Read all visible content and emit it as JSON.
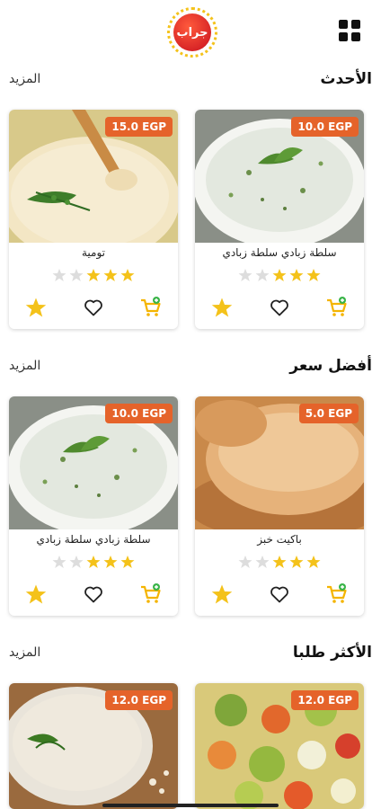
{
  "header": {
    "logo_text": "جراب",
    "menu_icon": "grid-menu-icon"
  },
  "sections": [
    {
      "title": "الأحدث",
      "more_label": "المزيد",
      "cards": [
        {
          "name": "سلطة زبادي سلطة زبادي",
          "price": "10.0 EGP",
          "rating": 3,
          "max_rating": 5,
          "image": "yogurt-salad"
        },
        {
          "name": "تومية",
          "price": "15.0 EGP",
          "rating": 3,
          "max_rating": 5,
          "image": "garlic-dip"
        }
      ]
    },
    {
      "title": "أفضل سعر",
      "more_label": "المزيد",
      "cards": [
        {
          "name": "باكيت خبز",
          "price": "5.0 EGP",
          "rating": 3,
          "max_rating": 5,
          "image": "bread"
        },
        {
          "name": "سلطة زبادي سلطة زبادي",
          "price": "10.0 EGP",
          "rating": 3,
          "max_rating": 5,
          "image": "yogurt-salad"
        }
      ]
    },
    {
      "title": "الأكثر طلبا",
      "more_label": "المزيد",
      "cards": [
        {
          "name": "",
          "price": "12.0 EGP",
          "rating": 0,
          "max_rating": 5,
          "image": "pickles"
        },
        {
          "name": "",
          "price": "12.0 EGP",
          "rating": 0,
          "max_rating": 5,
          "image": "tahini"
        }
      ]
    }
  ],
  "colors": {
    "accent": "#e5632a",
    "star": "#f4c21a",
    "star_empty": "#dddddd",
    "cart": "#f4b400",
    "cart_plus": "#3bb54a"
  }
}
